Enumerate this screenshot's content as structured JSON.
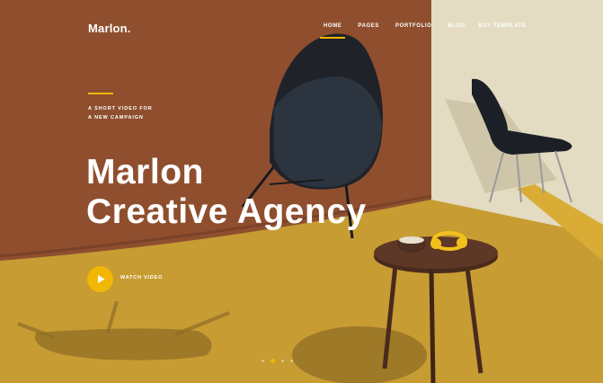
{
  "brand": {
    "logo": "Marlon."
  },
  "nav": {
    "items": [
      {
        "label": "HOME",
        "active": true
      },
      {
        "label": "PAGES"
      },
      {
        "label": "PORTFOLIO"
      },
      {
        "label": "BLOG"
      },
      {
        "label": "BUY TEMPLATE"
      }
    ]
  },
  "hero": {
    "kicker_line1": "A SHORT VIDEO FOR",
    "kicker_line2": "A NEW CAMPAIGN",
    "title_line1": "Marlon",
    "title_line2": "Creative Agency",
    "watch_label": "WATCH VIDEO",
    "play_icon": "play-icon"
  },
  "slider": {
    "slides": 4,
    "active_index": 1
  },
  "colors": {
    "accent": "#f2b705",
    "text": "#ffffff",
    "backdrop": "#8e4f2e",
    "floor": "#c59a30"
  }
}
